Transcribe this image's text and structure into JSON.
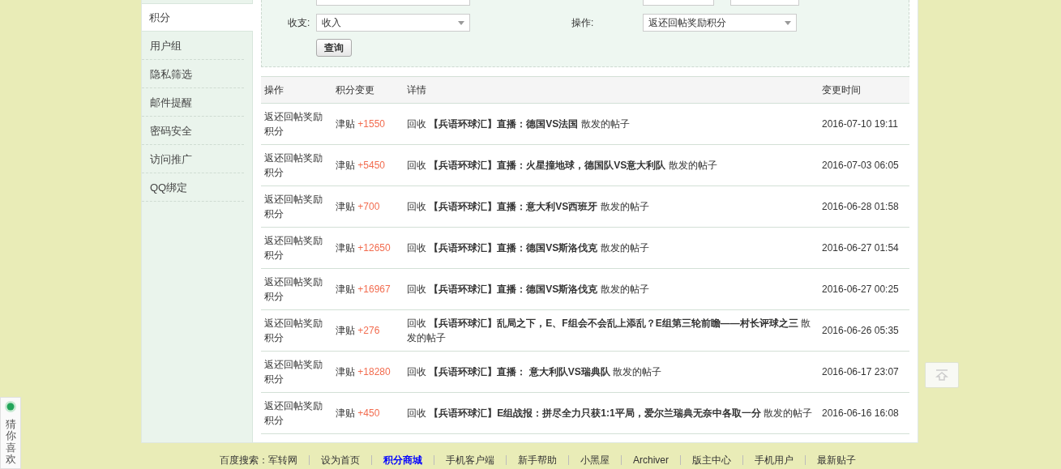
{
  "sidebar": {
    "items": [
      {
        "label": "积分",
        "selected": true
      },
      {
        "label": "用户组",
        "selected": false
      },
      {
        "label": "隐私筛选",
        "selected": false
      },
      {
        "label": "邮件提醒",
        "selected": false
      },
      {
        "label": "密码安全",
        "selected": false
      },
      {
        "label": "访问推广",
        "selected": false
      },
      {
        "label": "QQ绑定",
        "selected": false
      }
    ]
  },
  "filters": {
    "income_label": "收支:",
    "income_value": "收入",
    "operation_label": "操作:",
    "operation_value": "返还回帖奖励积分",
    "query_button": "查询"
  },
  "table": {
    "columns": [
      "操作",
      "积分变更",
      "详情",
      "变更时间"
    ],
    "rows": [
      {
        "operation": "返还回帖奖励积分",
        "credit_type": "津贴",
        "amount": "+1550",
        "detail": "回收 **【兵语环球汇】直播：德国VS法国** 散发的帖子",
        "time": "2016-07-10 19:11"
      },
      {
        "operation": "返还回帖奖励积分",
        "credit_type": "津贴",
        "amount": "+5450",
        "detail": "回收 **【兵语环球汇】直播：火星撞地球，德国队VS意大利队** 散发的帖子",
        "time": "2016-07-03 06:05"
      },
      {
        "operation": "返还回帖奖励积分",
        "credit_type": "津贴",
        "amount": "+700",
        "detail": "回收 **【兵语环球汇】直播：意大利VS西班牙** 散发的帖子",
        "time": "2016-06-28 01:58"
      },
      {
        "operation": "返还回帖奖励积分",
        "credit_type": "津贴",
        "amount": "+12650",
        "detail": "回收 **【兵语环球汇】直播：德国VS斯洛伐克** 散发的帖子",
        "time": "2016-06-27 01:54"
      },
      {
        "operation": "返还回帖奖励积分",
        "credit_type": "津贴",
        "amount": "+16967",
        "detail": "回收 **【兵语环球汇】直播：德国VS斯洛伐克** 散发的帖子",
        "time": "2016-06-27 00:25"
      },
      {
        "operation": "返还回帖奖励积分",
        "credit_type": "津贴",
        "amount": "+276",
        "detail": "回收 **【兵语环球汇】乱局之下，E、F组会不会乱上添乱？E组第三轮前瞻——村长评球之三** 散发的帖子",
        "time": "2016-06-26 05:35"
      },
      {
        "operation": "返还回帖奖励积分",
        "credit_type": "津贴",
        "amount": "+18280",
        "detail": "回收 **【兵语环球汇】直播： 意大利队VS瑞典队** 散发的帖子",
        "time": "2016-06-17 23:07"
      },
      {
        "operation": "返还回帖奖励积分",
        "credit_type": "津贴",
        "amount": "+450",
        "detail": "回收 **【兵语环球汇】E组战报：拼尽全力只获1:1平局，爱尔兰瑞典无奈中各取一分** 散发的帖子",
        "time": "2016-06-16 16:08"
      }
    ]
  },
  "footer_links": [
    {
      "label": "百度搜索：军转网",
      "highlighted": false
    },
    {
      "label": "设为首页",
      "highlighted": false
    },
    {
      "label": "积分商城",
      "highlighted": true
    },
    {
      "label": "手机客户端",
      "highlighted": false
    },
    {
      "label": "新手帮助",
      "highlighted": false
    },
    {
      "label": "小黑屋",
      "highlighted": false
    },
    {
      "label": "Archiver",
      "highlighted": false
    },
    {
      "label": "版主中心",
      "highlighted": false
    },
    {
      "label": "手机用户",
      "highlighted": false
    },
    {
      "label": "最新贴子",
      "highlighted": false
    }
  ],
  "side_widget": {
    "label": "猜你喜欢"
  }
}
